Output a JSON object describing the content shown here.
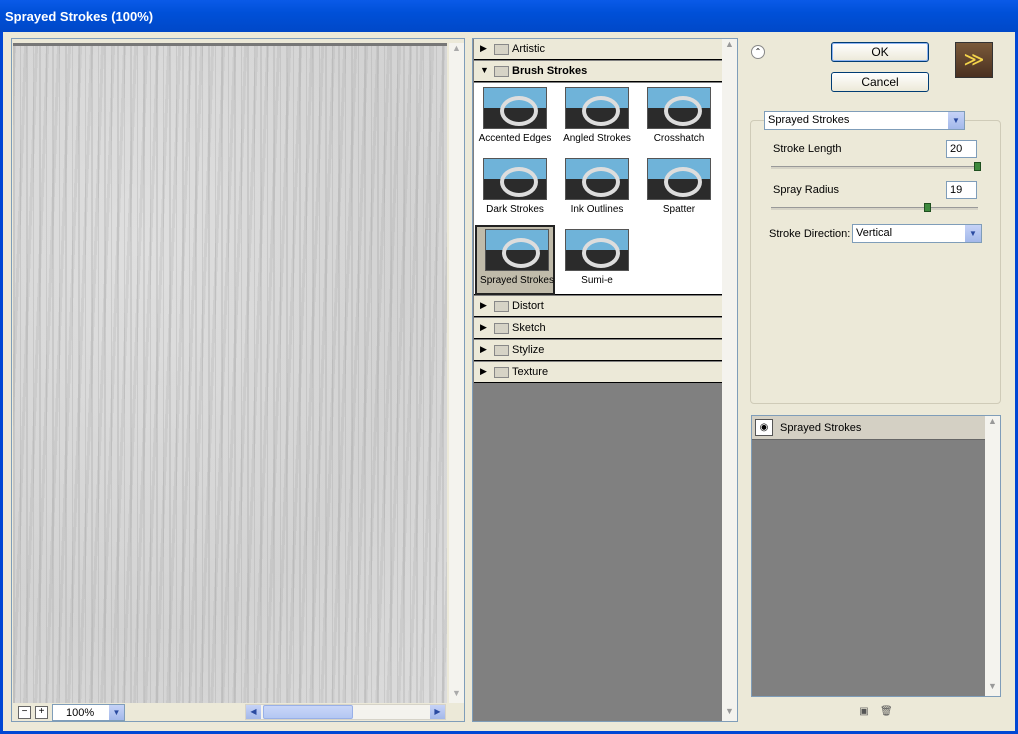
{
  "window": {
    "title": "Sprayed Strokes (100%)"
  },
  "preview": {
    "zoom": "100%",
    "zoom_out": "−",
    "zoom_in": "+"
  },
  "gallery": {
    "categories": [
      {
        "label": "Artistic",
        "state": "collapsed"
      },
      {
        "label": "Brush Strokes",
        "state": "expanded"
      },
      {
        "label": "Distort",
        "state": "collapsed"
      },
      {
        "label": "Sketch",
        "state": "collapsed"
      },
      {
        "label": "Stylize",
        "state": "collapsed"
      },
      {
        "label": "Texture",
        "state": "collapsed"
      }
    ],
    "filters": [
      {
        "label": "Accented Edges"
      },
      {
        "label": "Angled Strokes"
      },
      {
        "label": "Crosshatch"
      },
      {
        "label": "Dark Strokes"
      },
      {
        "label": "Ink Outlines"
      },
      {
        "label": "Spatter"
      },
      {
        "label": "Sprayed Strokes",
        "selected": true
      },
      {
        "label": "Sumi-e"
      }
    ]
  },
  "buttons": {
    "ok": "OK",
    "cancel": "Cancel"
  },
  "settings": {
    "filter_select": "Sprayed Strokes",
    "stroke_length_label": "Stroke Length",
    "stroke_length_value": "20",
    "stroke_length_fraction": 1.0,
    "spray_radius_label": "Spray Radius",
    "spray_radius_value": "19",
    "spray_radius_fraction": 0.76,
    "stroke_direction_label": "Stroke Direction:",
    "stroke_direction_value": "Vertical"
  },
  "layers": {
    "items": [
      {
        "label": "Sprayed Strokes",
        "visible": true
      }
    ]
  },
  "icons": {
    "collapse": "collapse-chevron-icon",
    "logo": "photoshop-filter-logo-icon",
    "eye": "eye-icon",
    "new_layer": "new-effect-layer-icon",
    "delete_layer": "trash-icon"
  },
  "colors": {
    "title_bar": "#0050d8",
    "dialog_bg": "#ece9d8",
    "gallery_bg": "#808080",
    "slider_knob": "#3e8a3e"
  }
}
